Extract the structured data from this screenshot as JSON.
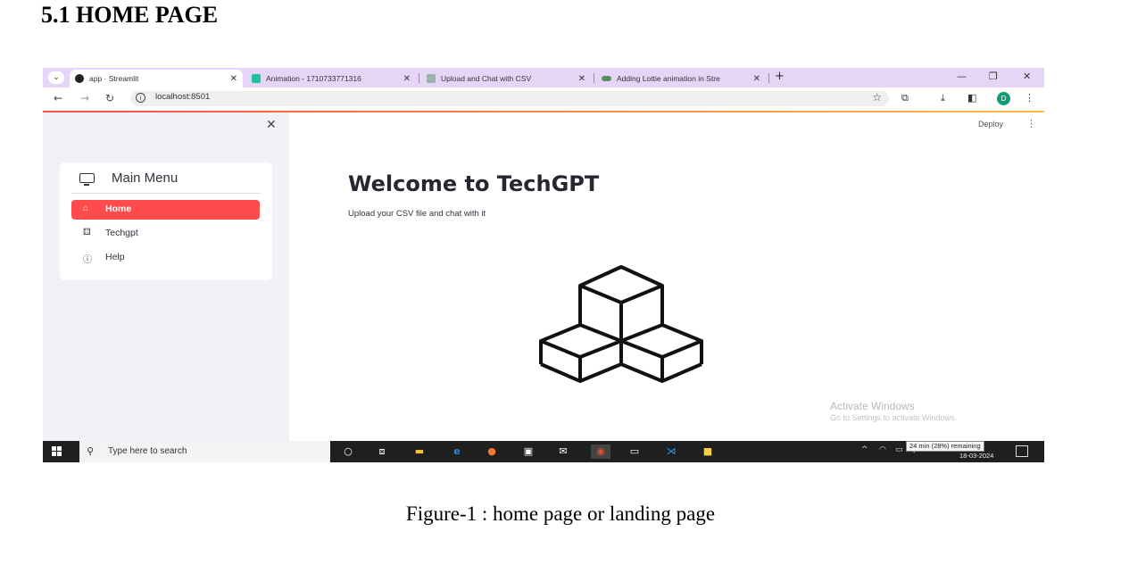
{
  "document": {
    "heading": "5.1 HOME PAGE",
    "caption": "Figure-1 : home page or landing page"
  },
  "browser": {
    "tabs": [
      {
        "label": "app · Streamlit",
        "icon": "streamlit-icon",
        "active": true
      },
      {
        "label": "Animation - 1710733771316",
        "icon": "lottie-icon",
        "active": false
      },
      {
        "label": "Upload and Chat with CSV",
        "icon": "chatgpt-icon",
        "active": false
      },
      {
        "label": "Adding Lottie animation in Stre",
        "icon": "github-icon",
        "active": false
      }
    ],
    "url": "localhost:8501",
    "profile_initial": "D"
  },
  "app": {
    "sidebar": {
      "menu_title": "Main Menu",
      "items": [
        {
          "label": "Home",
          "icon": "home-icon",
          "active": true
        },
        {
          "label": "Techgpt",
          "icon": "boxes-icon",
          "active": false
        },
        {
          "label": "Help",
          "icon": "question-icon",
          "active": false
        }
      ]
    },
    "header": {
      "deploy_label": "Deploy"
    },
    "main": {
      "title": "Welcome to TechGPT",
      "subtitle": "Upload your CSV file and chat with it"
    },
    "accent_color": "#ff4b4b"
  },
  "os": {
    "watermark_title": "Activate Windows",
    "watermark_sub": "Go to Settings to activate Windows.",
    "search_placeholder": "Type here to search",
    "battery_tooltip": "24 min (28%) remaining",
    "date": "18-03-2024"
  }
}
